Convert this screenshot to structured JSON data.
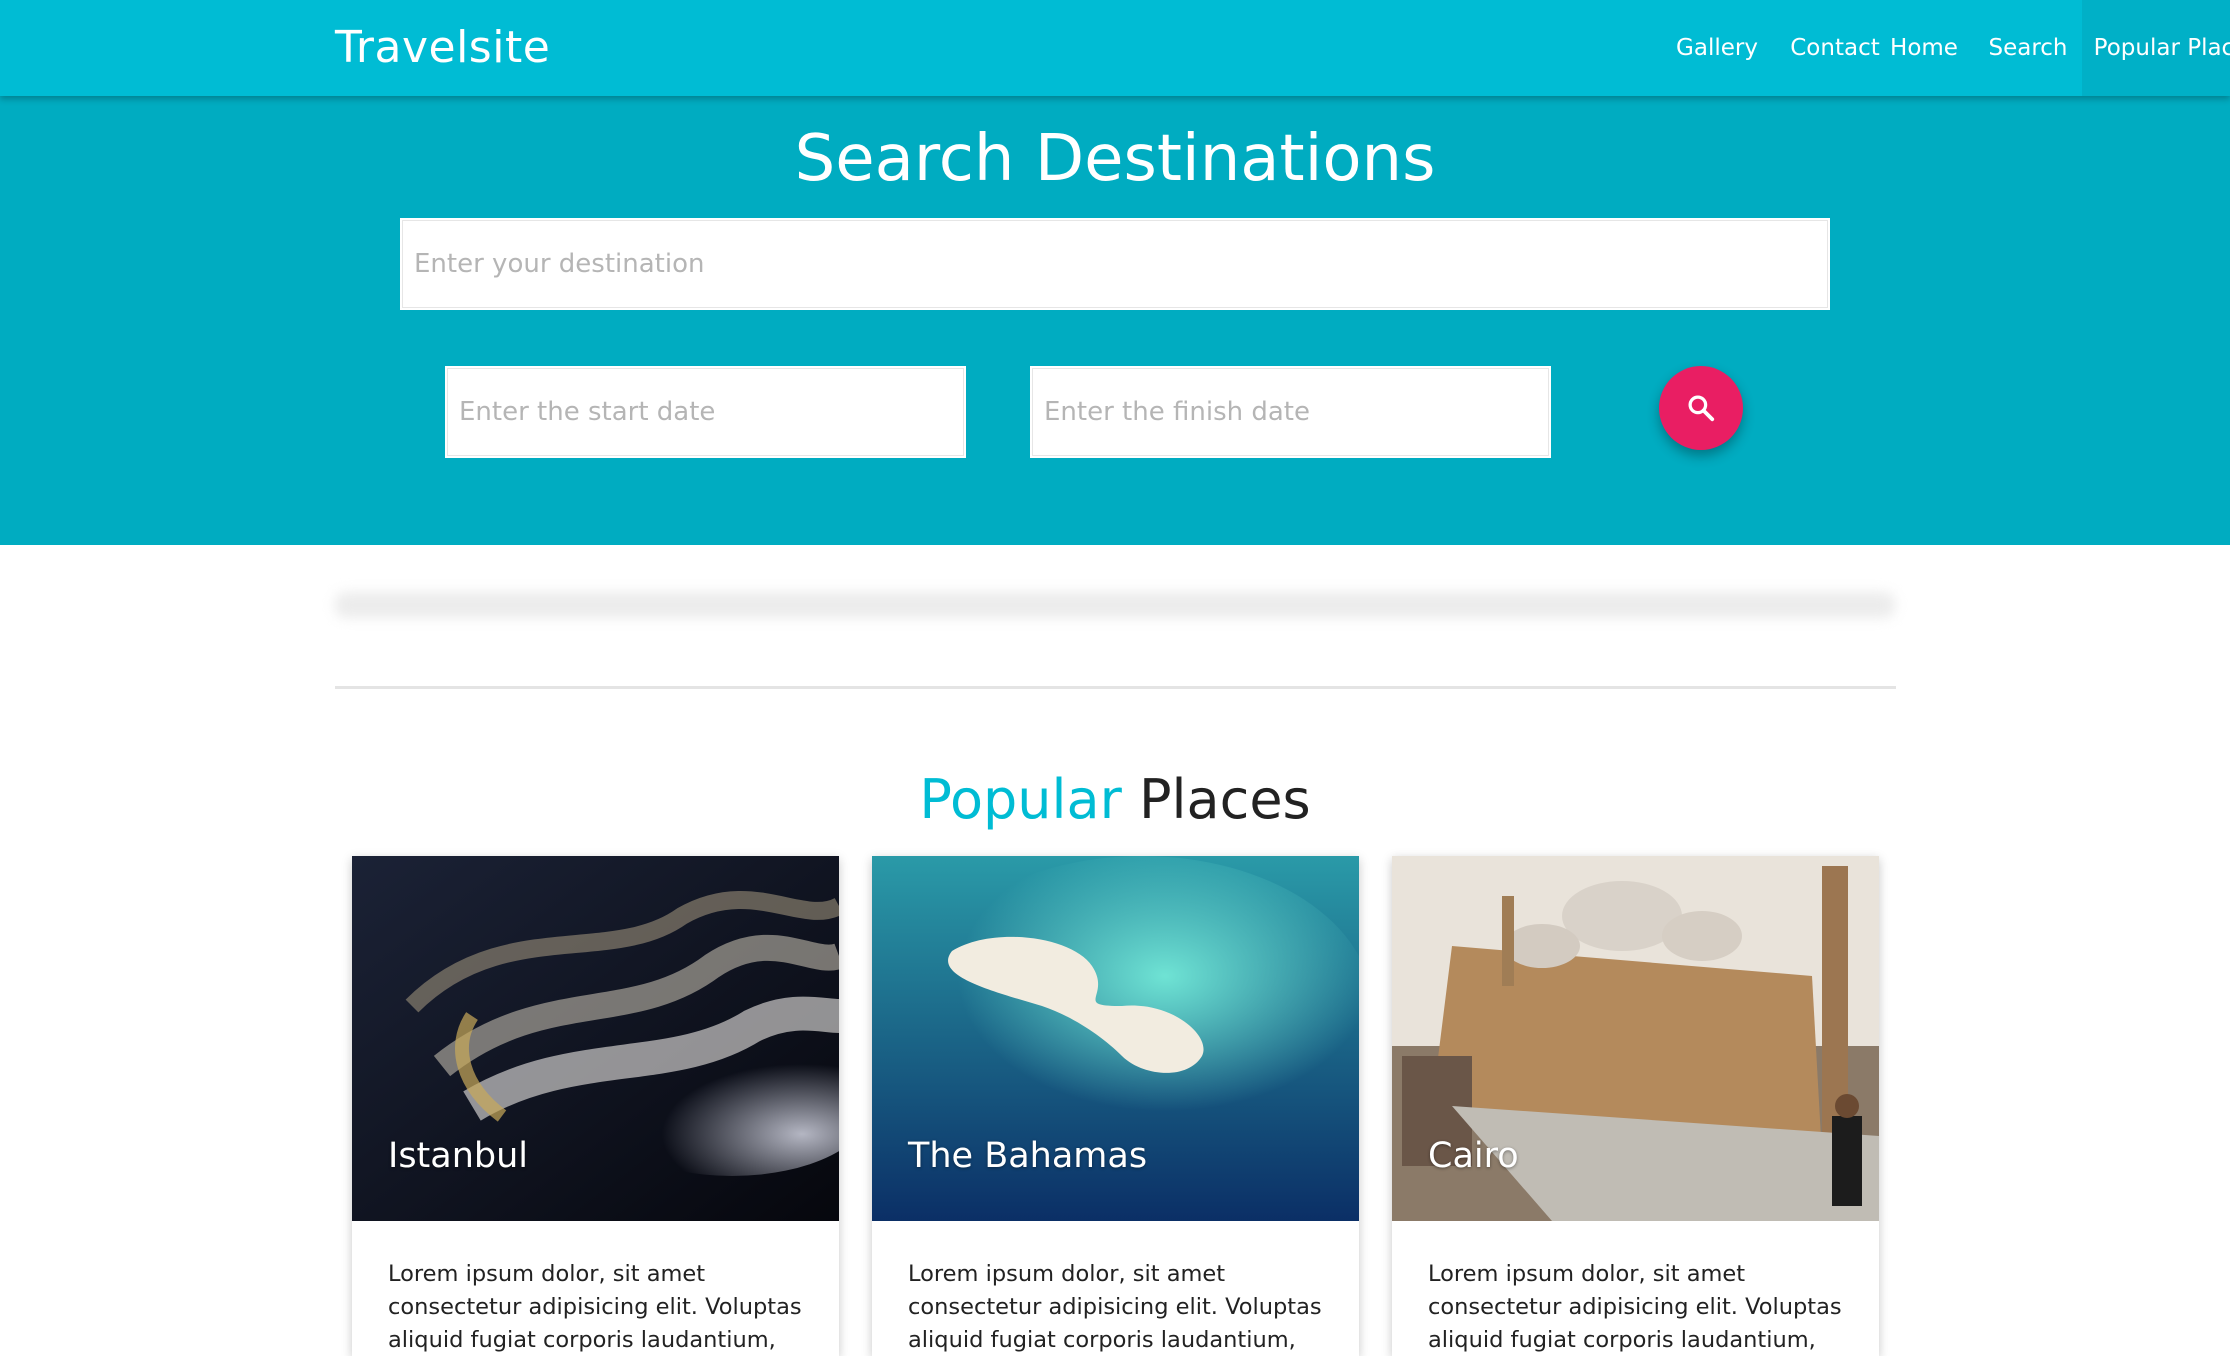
{
  "brand": "Travelsite",
  "nav": {
    "items": [
      "Home",
      "Search",
      "Popular Places",
      "Gallery",
      "Contact"
    ],
    "active": "Popular Places"
  },
  "hero": {
    "title": "Search Destinations",
    "destination_placeholder": "Enter your destination",
    "start_placeholder": "Enter the start date",
    "finish_placeholder": "Enter the finish date"
  },
  "section": {
    "title_accent": "Popular",
    "title_rest": "Places"
  },
  "cards": [
    {
      "title": "Istanbul",
      "text": "Lorem ipsum dolor, sit amet consectetur adipisicing elit. Voluptas aliquid fugiat corporis laudantium, architecto delectus?"
    },
    {
      "title": "The Bahamas",
      "text": "Lorem ipsum dolor, sit amet consectetur adipisicing elit. Voluptas aliquid fugiat corporis laudantium, architecto delectus?"
    },
    {
      "title": "Cairo",
      "text": "Lorem ipsum dolor, sit amet consectetur adipisicing elit. Voluptas aliquid fugiat corporis laudantium, architecto delectus?"
    }
  ],
  "colors": {
    "navbar": "#00bcd4",
    "hero": "#00acc1",
    "accent": "#00bcd4",
    "search_button": "#e91e63"
  },
  "icons": {
    "search_button": "search-icon"
  }
}
